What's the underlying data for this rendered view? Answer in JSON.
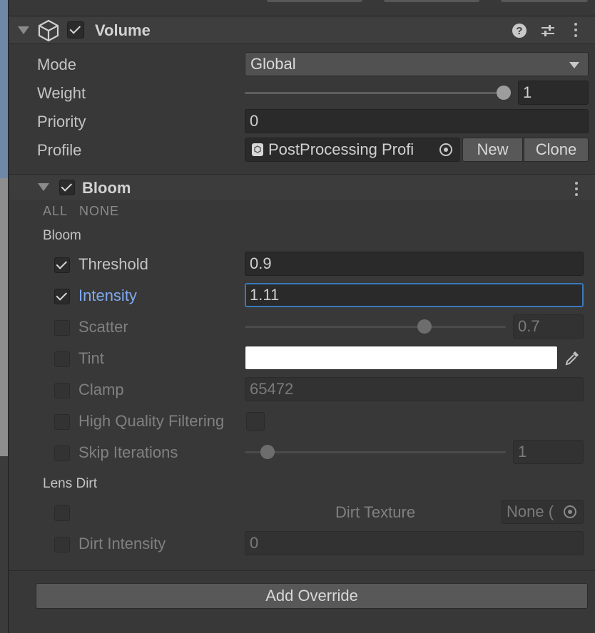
{
  "component": {
    "title": "Volume",
    "enabled": true,
    "icons": [
      "help-icon",
      "presets-icon",
      "kebab-menu-icon"
    ]
  },
  "volume": {
    "mode_label": "Mode",
    "mode_value": "Global",
    "weight_label": "Weight",
    "weight_value": "1",
    "weight_fraction": 1.0,
    "priority_label": "Priority",
    "priority_value": "0",
    "profile_label": "Profile",
    "profile_value": "PostProcessing Profi",
    "new_button": "New",
    "clone_button": "Clone"
  },
  "bloom": {
    "title": "Bloom",
    "enabled": true,
    "all_label": "ALL",
    "none_label": "NONE",
    "group_bloom": "Bloom",
    "group_lens_dirt": "Lens Dirt",
    "threshold": {
      "label": "Threshold",
      "value": "0.9",
      "override": true
    },
    "intensity": {
      "label": "Intensity",
      "value": "1.11",
      "override": true
    },
    "scatter": {
      "label": "Scatter",
      "value": "0.7",
      "override": false,
      "fraction": 0.7
    },
    "tint": {
      "label": "Tint",
      "color": "#ffffff",
      "override": false
    },
    "clamp": {
      "label": "Clamp",
      "value": "65472",
      "override": false
    },
    "high_quality": {
      "label": "High Quality Filtering",
      "override": false
    },
    "skip_iterations": {
      "label": "Skip Iterations",
      "value": "1",
      "override": false,
      "fraction": 0.1
    },
    "dirt_texture": {
      "label": "Dirt Texture",
      "value": "None (",
      "override": false
    },
    "dirt_intensity": {
      "label": "Dirt Intensity",
      "value": "0",
      "override": false
    }
  },
  "footer": {
    "add_override": "Add Override"
  },
  "colors": {
    "accent_focus": "#3a79bb",
    "label_highlight": "#7fa8ef"
  }
}
